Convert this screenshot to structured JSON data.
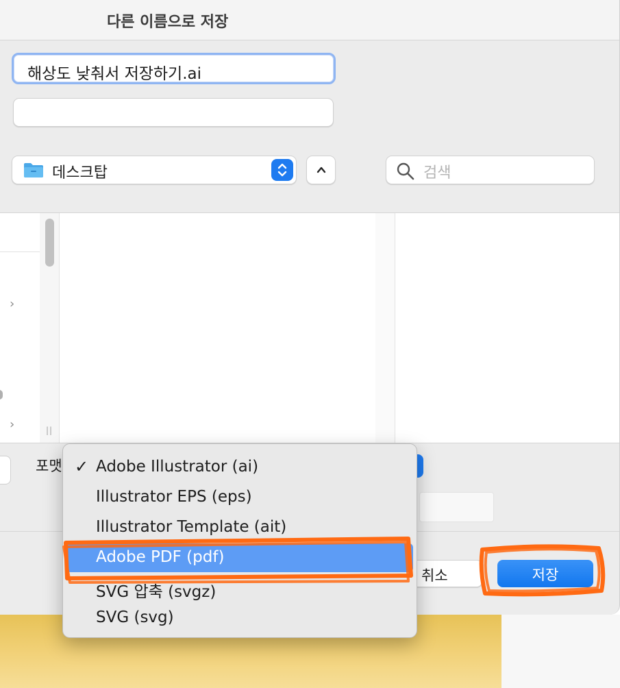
{
  "dialog": {
    "title": "다른 이름으로 저장",
    "filename": "해상도 낮춰서 저장하기.ai",
    "tags_value": "",
    "location": "데스크탑",
    "search_placeholder": "검색",
    "format_label": "포맷",
    "cancel_label": "취소",
    "save_label": "저장"
  },
  "format_menu": {
    "items": [
      {
        "label": "Adobe Illustrator (ai)",
        "checked": true,
        "highlighted": false
      },
      {
        "label": "Illustrator EPS (eps)",
        "checked": false,
        "highlighted": false
      },
      {
        "label": "Illustrator Template (ait)",
        "checked": false,
        "highlighted": false
      },
      {
        "label": "Adobe PDF (pdf)",
        "checked": false,
        "highlighted": true
      },
      {
        "label": "SVG 압축 (svgz)",
        "checked": false,
        "highlighted": false
      },
      {
        "label": "SVG (svg)",
        "checked": false,
        "highlighted": false
      }
    ],
    "check_mark": "✓"
  },
  "colors": {
    "accent": "#1e7bf0",
    "highlight": "#5d9cf5",
    "annotation": "#ff6a13"
  },
  "icons": [
    "folder-icon",
    "chevron-updown-icon",
    "chevron-up-icon",
    "search-icon",
    "chevron-right-icon"
  ]
}
